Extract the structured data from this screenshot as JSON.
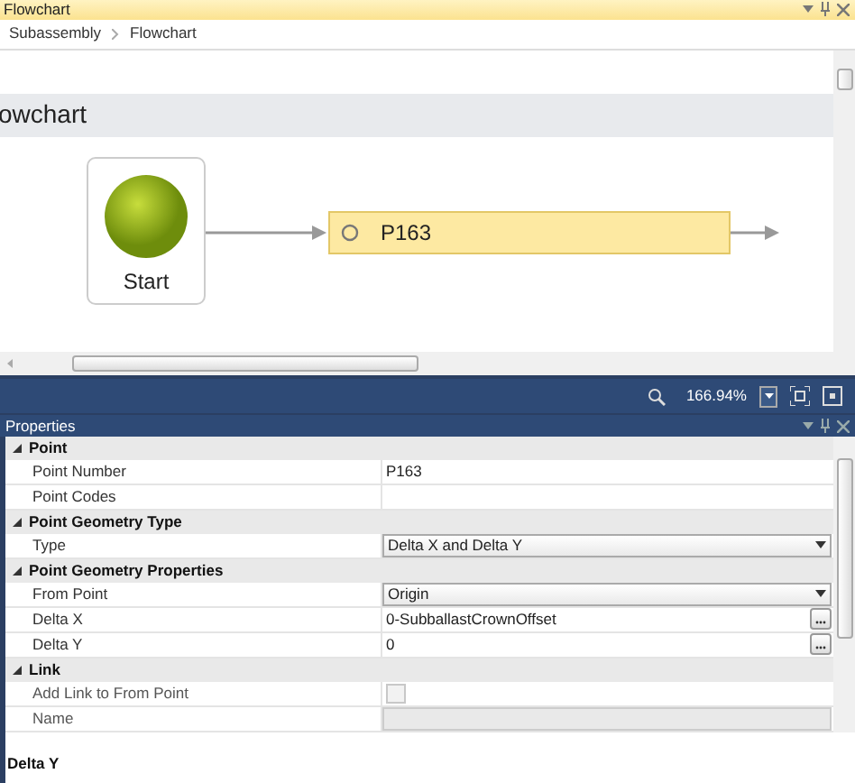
{
  "flowchart_panel": {
    "title": "Flowchart",
    "breadcrumb": [
      "Subassembly",
      "Flowchart"
    ],
    "canvas_title": "owchart",
    "nodes": [
      {
        "kind": "start",
        "label": "Start"
      },
      {
        "kind": "point",
        "label": "P163"
      }
    ],
    "zoom": "166.94%"
  },
  "properties_panel": {
    "title": "Properties",
    "categories": [
      {
        "name": "Point",
        "expanded": true,
        "rows": [
          {
            "label": "Point Number",
            "kind": "text",
            "value": "P163",
            "disabled": false
          },
          {
            "label": "Point Codes",
            "kind": "text",
            "disabled": false
          }
        ]
      },
      {
        "name": "Point Geometry Type",
        "expanded": true,
        "rows": [
          {
            "label": "Type",
            "kind": "dropdown",
            "value": "Delta X and Delta Y",
            "disabled": false
          }
        ]
      },
      {
        "name": "Point Geometry Properties",
        "expanded": true,
        "rows": [
          {
            "label": "From Point",
            "kind": "dropdown",
            "value": "Origin",
            "disabled": false
          },
          {
            "label": "Delta X",
            "kind": "expression",
            "value": "0-SubballastCrownOffset",
            "disabled": false
          },
          {
            "label": "Delta Y",
            "kind": "expression",
            "value": "0",
            "disabled": false
          }
        ]
      },
      {
        "name": "Link",
        "expanded": true,
        "rows": [
          {
            "label": "Add Link to From Point",
            "kind": "checkbox",
            "checked": false,
            "disabled": true
          },
          {
            "label": "Name",
            "kind": "text",
            "disabled": true
          }
        ]
      }
    ],
    "description": "Delta Y"
  }
}
